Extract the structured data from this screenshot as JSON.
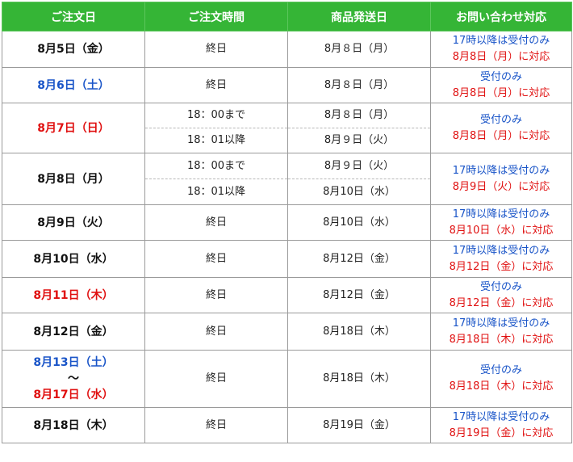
{
  "headers": [
    "ご注文日",
    "ご注文時間",
    "商品発送日",
    "お問い合わせ対応"
  ],
  "colors": {
    "header_bg": "#35b536",
    "weekday": "#111111",
    "saturday": "#1a55c8",
    "holiday": "#e01010",
    "border": "#9a9a9a"
  },
  "rows": [
    {
      "order_date": [
        {
          "text": "8月5日（金）",
          "color": "black"
        }
      ],
      "parts": [
        {
          "time": "終日",
          "ship": "8月８日（月）"
        }
      ],
      "inquiry": [
        {
          "text": "17時以降は受付のみ",
          "color": "blue"
        },
        {
          "text": "8月8日（月）に対応",
          "color": "red"
        }
      ]
    },
    {
      "order_date": [
        {
          "text": "8月6日（土）",
          "color": "blue"
        }
      ],
      "parts": [
        {
          "time": "終日",
          "ship": "8月８日（月）"
        }
      ],
      "inquiry": [
        {
          "text": "受付のみ",
          "color": "blue"
        },
        {
          "text": "8月8日（月）に対応",
          "color": "red"
        }
      ]
    },
    {
      "order_date": [
        {
          "text": "8月7日（日）",
          "color": "red"
        }
      ],
      "parts": [
        {
          "time": "18：00まで",
          "ship": "8月８日（月）"
        },
        {
          "time": "18：01以降",
          "ship": "8月９日（火）"
        }
      ],
      "inquiry": [
        {
          "text": "受付のみ",
          "color": "blue"
        },
        {
          "text": "8月8日（月）に対応",
          "color": "red"
        }
      ]
    },
    {
      "order_date": [
        {
          "text": "8月8日（月）",
          "color": "black"
        }
      ],
      "parts": [
        {
          "time": "18：00まで",
          "ship": "8月９日（火）"
        },
        {
          "time": "18：01以降",
          "ship": "8月10日（水）"
        }
      ],
      "inquiry": [
        {
          "text": "17時以降は受付のみ",
          "color": "blue"
        },
        {
          "text": "8月9日（火）に対応",
          "color": "red"
        }
      ]
    },
    {
      "order_date": [
        {
          "text": "8月9日（火）",
          "color": "black"
        }
      ],
      "parts": [
        {
          "time": "終日",
          "ship": "8月10日（水）"
        }
      ],
      "inquiry": [
        {
          "text": "17時以降は受付のみ",
          "color": "blue"
        },
        {
          "text": "8月10日（水）に対応",
          "color": "red"
        }
      ]
    },
    {
      "order_date": [
        {
          "text": "8月10日（水）",
          "color": "black"
        }
      ],
      "parts": [
        {
          "time": "終日",
          "ship": "8月12日（金）"
        }
      ],
      "inquiry": [
        {
          "text": "17時以降は受付のみ",
          "color": "blue"
        },
        {
          "text": "8月12日（金）に対応",
          "color": "red"
        }
      ]
    },
    {
      "order_date": [
        {
          "text": "8月11日（木）",
          "color": "red"
        }
      ],
      "parts": [
        {
          "time": "終日",
          "ship": "8月12日（金）"
        }
      ],
      "inquiry": [
        {
          "text": "受付のみ",
          "color": "blue"
        },
        {
          "text": "8月12日（金）に対応",
          "color": "red"
        }
      ]
    },
    {
      "order_date": [
        {
          "text": "8月12日（金）",
          "color": "black"
        }
      ],
      "parts": [
        {
          "time": "終日",
          "ship": "8月18日（木）"
        }
      ],
      "inquiry": [
        {
          "text": "17時以降は受付のみ",
          "color": "blue"
        },
        {
          "text": "8月18日（木）に対応",
          "color": "red"
        }
      ]
    },
    {
      "order_date": [
        {
          "text": "8月13日（土）",
          "color": "blue"
        },
        {
          "text": "～",
          "color": "black"
        },
        {
          "text": "8月17日（水）",
          "color": "red"
        }
      ],
      "parts": [
        {
          "time": "終日",
          "ship": "8月18日（木）"
        }
      ],
      "inquiry": [
        {
          "text": "受付のみ",
          "color": "blue"
        },
        {
          "text": "8月18日（木）に対応",
          "color": "red"
        }
      ]
    },
    {
      "order_date": [
        {
          "text": "8月18日（木）",
          "color": "black"
        }
      ],
      "parts": [
        {
          "time": "終日",
          "ship": "8月19日（金）"
        }
      ],
      "inquiry": [
        {
          "text": "17時以降は受付のみ",
          "color": "blue"
        },
        {
          "text": "8月19日（金）に対応",
          "color": "red"
        }
      ]
    }
  ]
}
